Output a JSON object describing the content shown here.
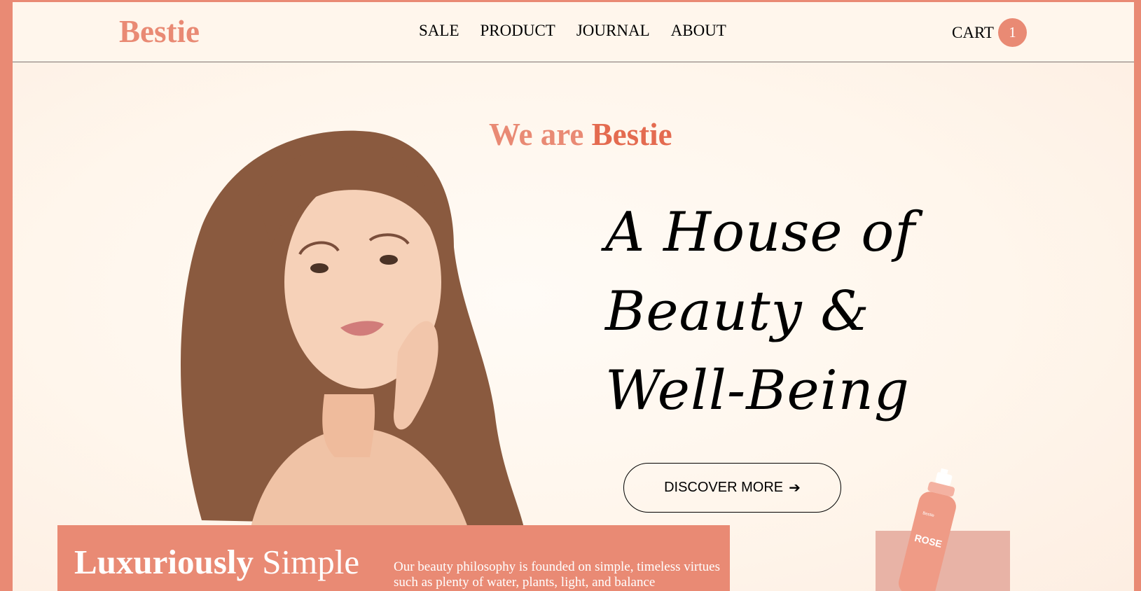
{
  "header": {
    "logo": "Bestie",
    "nav": [
      {
        "label": "SALE"
      },
      {
        "label": "PRODUCT"
      },
      {
        "label": "JOURNAL"
      },
      {
        "label": "ABOUT"
      }
    ],
    "cart_label": "CART",
    "cart_count": "1"
  },
  "hero": {
    "eyebrow_prefix": "We are",
    "eyebrow_brand": "Bestie",
    "headline_line1": "A House of",
    "headline_line2": "Beauty &",
    "headline_line3": "Well-Being",
    "cta_label": "DISCOVER MORE",
    "cta_arrow": "➔"
  },
  "feature": {
    "title_bold": "Luxuriously",
    "title_regular": "Simple",
    "description": "Our beauty philosophy is founded on simple, timeless virtues such as plenty of water, plants, light, and balance"
  },
  "product": {
    "bottle_label": "ROSE",
    "bottle_brand": "Bestie"
  },
  "colors": {
    "accent": "#e98a74",
    "accent_dark": "#e46b50",
    "background": "#fff6ec",
    "product_block": "#e8b3a6"
  }
}
